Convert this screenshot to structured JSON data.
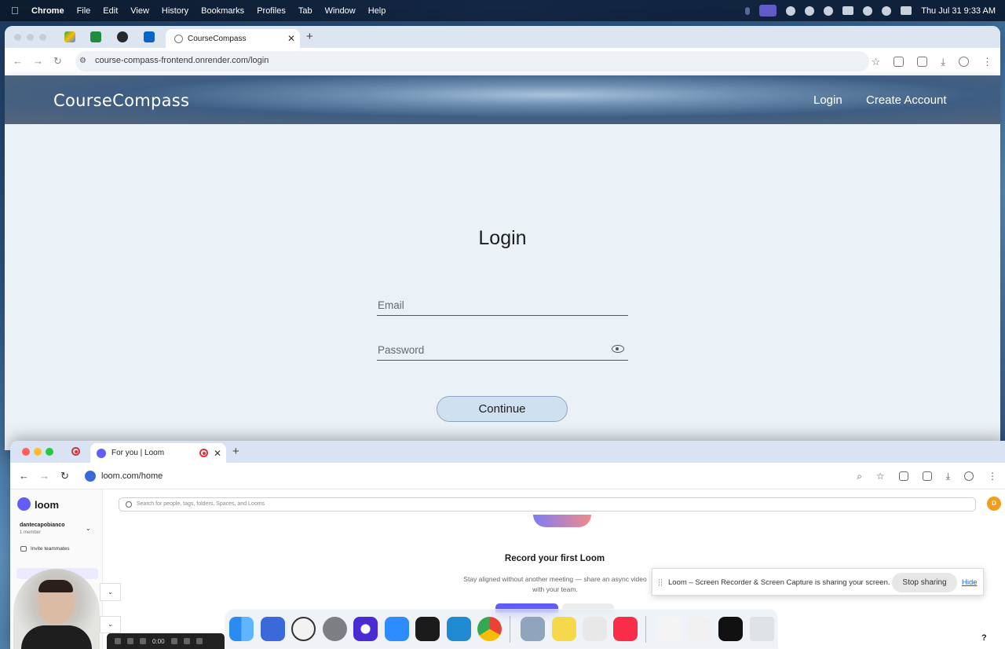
{
  "menubar": {
    "app_name": "Chrome",
    "menus": [
      "File",
      "Edit",
      "View",
      "History",
      "Bookmarks",
      "Profiles",
      "Tab",
      "Window",
      "Help"
    ],
    "clock": "Thu Jul 31  9:33 AM"
  },
  "browser1": {
    "tab_title": "CourseCompass",
    "url": "course-compass-frontend.onrender.com/login"
  },
  "site": {
    "logo": "CourseCompass",
    "nav_login": "Login",
    "nav_create_account": "Create Account",
    "form_title": "Login",
    "email_placeholder": "Email",
    "password_placeholder": "Password",
    "continue_label": "Continue"
  },
  "browser2": {
    "tab_title": "For you | Loom",
    "url": "loom.com/home"
  },
  "loom": {
    "brand": "loom",
    "workspace_name": "dantecapobianco",
    "workspace_members": "1 member",
    "invite_label": "Invite teammates",
    "search_placeholder": "Search for people, tags, folders, Spaces, and Looms",
    "avatar_initial": "D",
    "record_title": "Record your first Loom",
    "record_subtitle": "Stay aligned without another meeting — share an async video with your team.",
    "help_label": "?"
  },
  "share_banner": {
    "message": "Loom – Screen Recorder & Screen Capture is sharing your screen.",
    "stop_label": "Stop sharing",
    "hide_label": "Hide"
  },
  "recorder": {
    "timer": "0:00"
  },
  "colors": {
    "loom_brand": "#625df5",
    "continue_bg": "#cfe0f1",
    "avatar": "#f49d1c"
  }
}
